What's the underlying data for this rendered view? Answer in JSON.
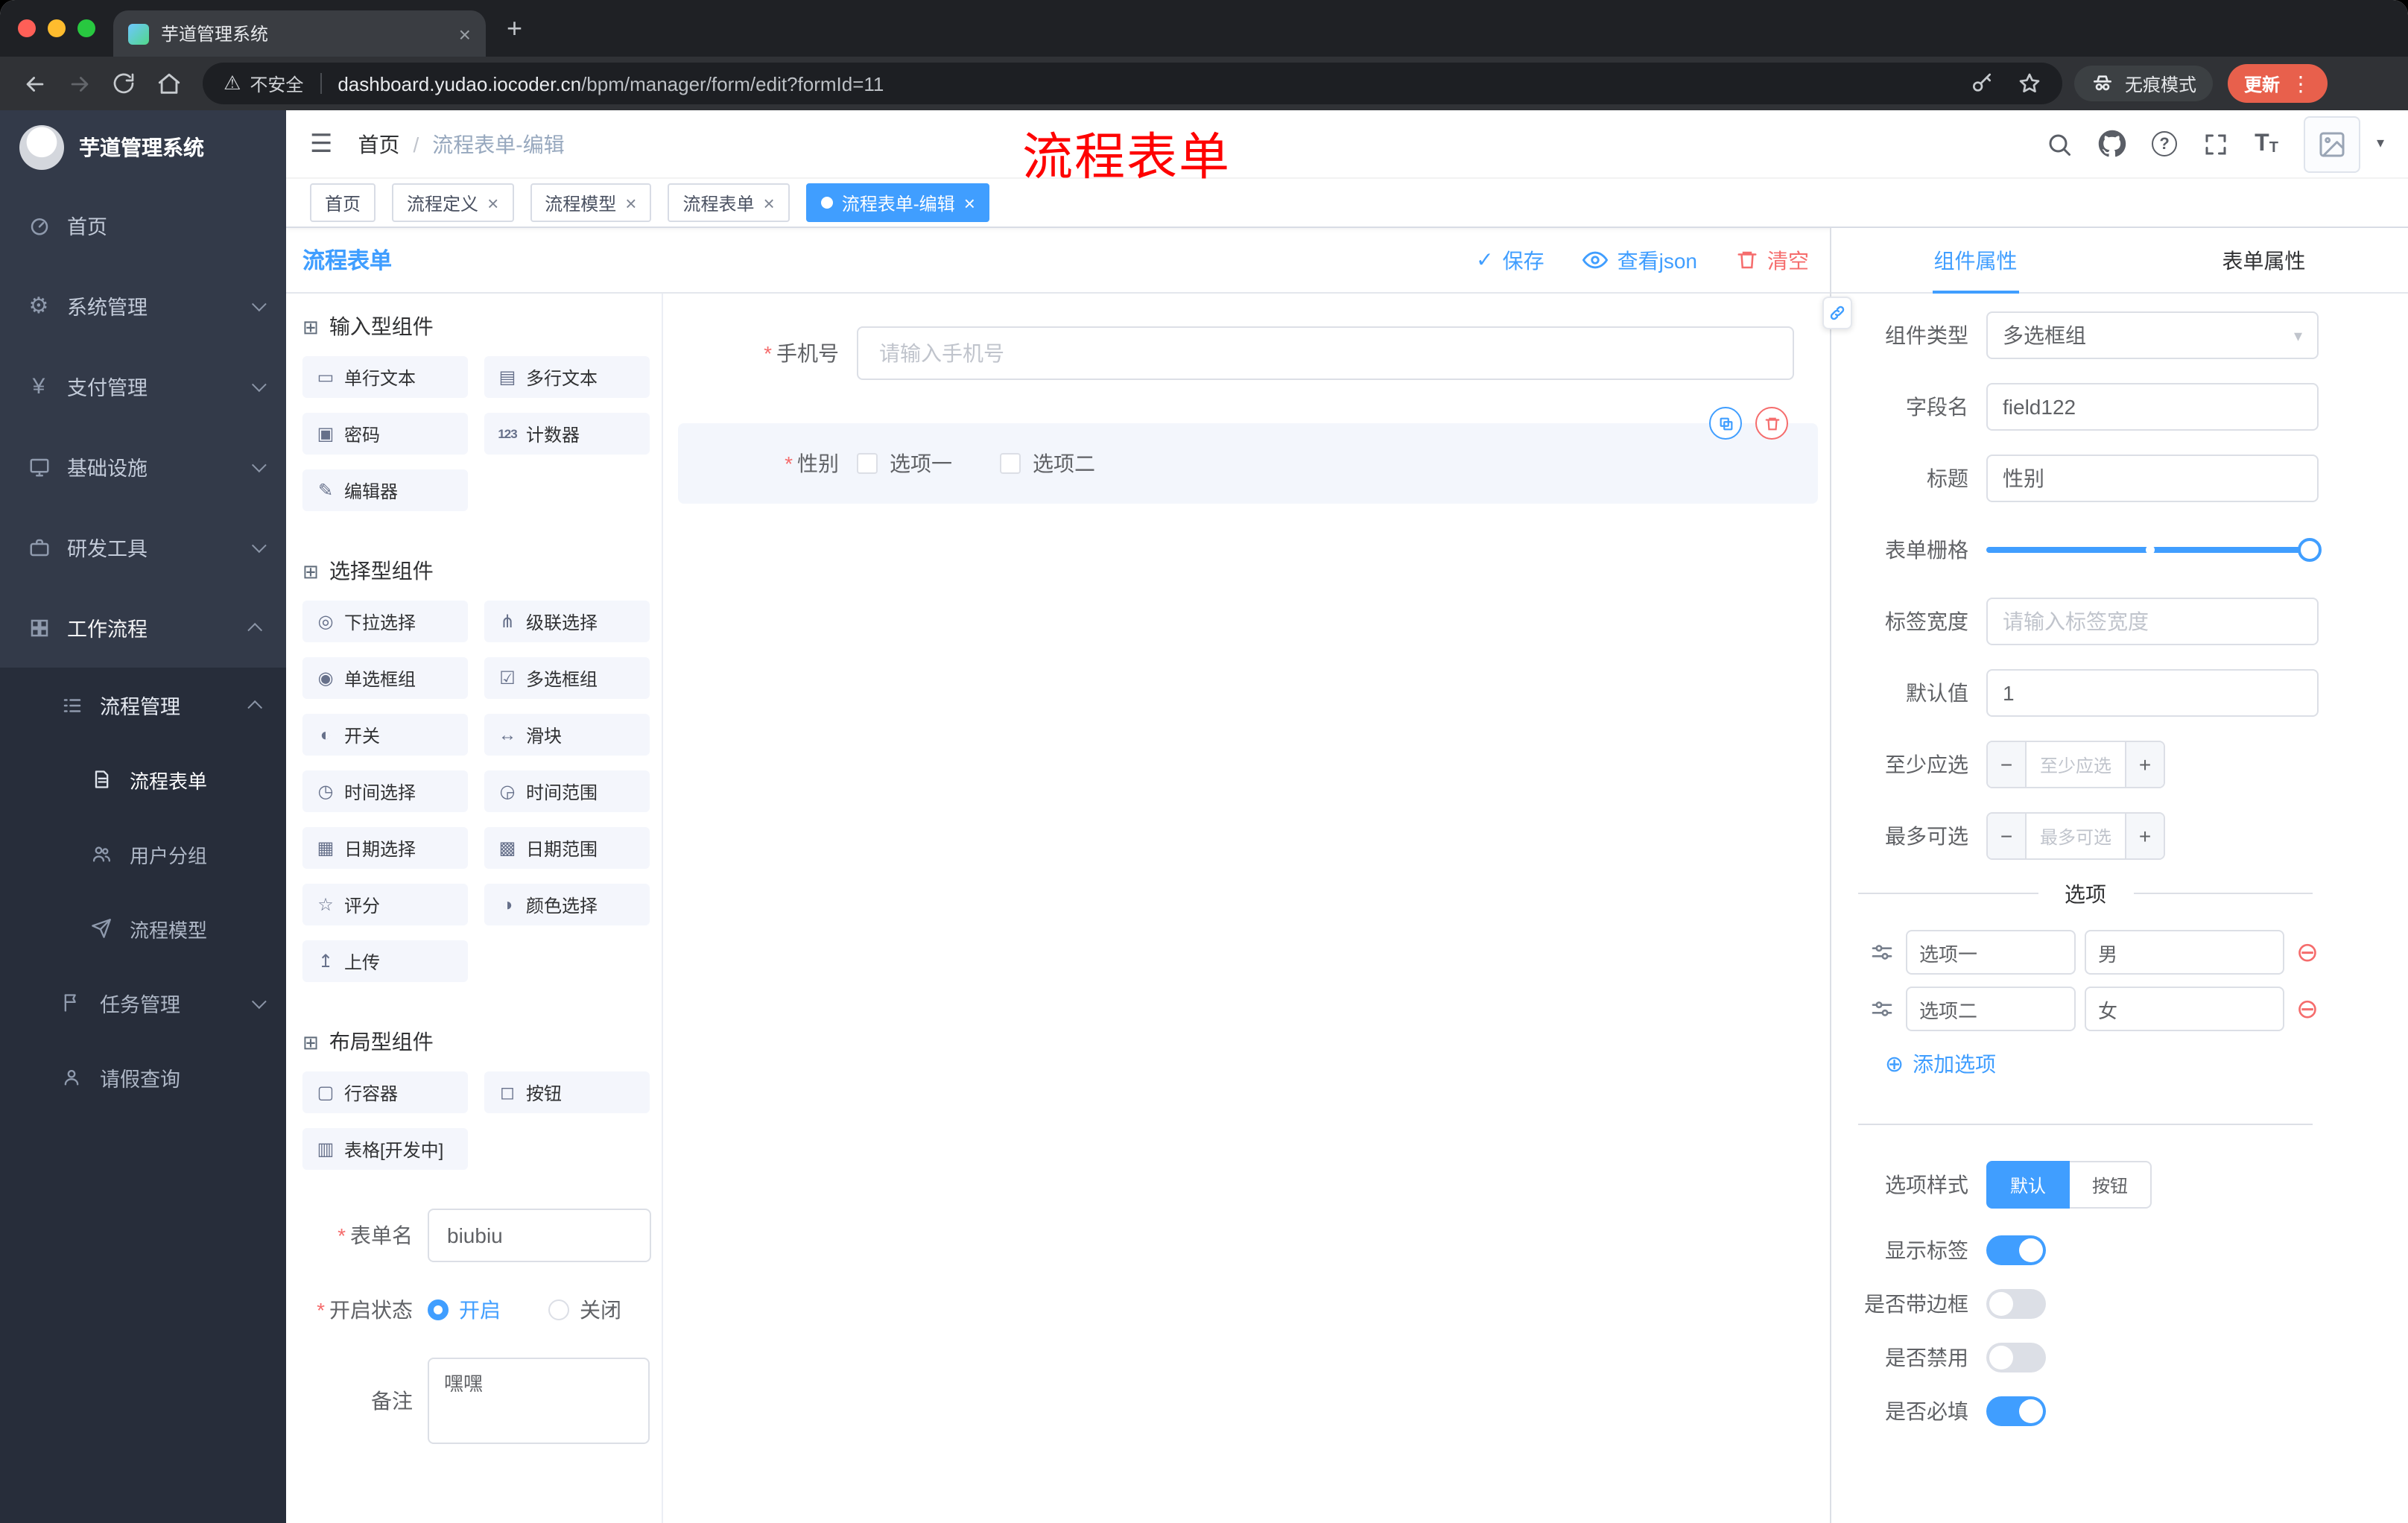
{
  "colors": {
    "accent": "#409eff",
    "danger": "#f56c6c",
    "sidebar_bg": "#333a49",
    "submenu_bg": "#272d3a",
    "annotation": "#fe0100",
    "update_pill": "#e8604c"
  },
  "glyphs": {
    "hamburger": "☰",
    "breadcrumb_sep": "/",
    "close": "×",
    "new_tab": "+",
    "kebab": "⋮",
    "caret_down": "▾",
    "warning": "⚠",
    "help": "?",
    "font_large": "T",
    "font_small": "T",
    "check": "✓",
    "add_circle": "⊕",
    "remove_circle": "⊖",
    "select_caret": "▾",
    "group_icon": "⊞",
    "required": "*",
    "gear": "⚙",
    "yen": "¥"
  },
  "browser": {
    "tab_title": "芋道管理系统",
    "security_label": "不安全",
    "url_host": "dashboard.yudao.iocoder.cn",
    "url_path": "/bpm/manager/form/edit?formId=11",
    "incognito_label": "无痕模式",
    "update_label": "更新"
  },
  "annotation": {
    "text": "流程表单"
  },
  "sidebar": {
    "logo_title": "芋道管理系统",
    "items": [
      {
        "label": "首页",
        "icon": "dashboard-icon"
      },
      {
        "label": "系统管理",
        "icon": "gear-icon"
      },
      {
        "label": "支付管理",
        "icon": "yen-icon"
      },
      {
        "label": "基础设施",
        "icon": "monitor-icon"
      },
      {
        "label": "研发工具",
        "icon": "briefcase-icon"
      },
      {
        "label": "工作流程",
        "icon": "grid-icon",
        "expanded": true
      }
    ],
    "submenu": [
      {
        "label": "流程管理",
        "icon": "list-icon",
        "expanded": true
      },
      {
        "label": "流程表单",
        "icon": "document-icon",
        "active": true
      },
      {
        "label": "用户分组",
        "icon": "users-icon"
      },
      {
        "label": "流程模型",
        "icon": "send-icon"
      },
      {
        "label": "任务管理",
        "icon": "flag-icon"
      },
      {
        "label": "请假查询",
        "icon": "user-icon"
      }
    ]
  },
  "header": {
    "breadcrumb_home": "首页",
    "breadcrumb_current": "流程表单-编辑"
  },
  "tags": [
    {
      "label": "首页"
    },
    {
      "label": "流程定义"
    },
    {
      "label": "流程模型"
    },
    {
      "label": "流程表单"
    },
    {
      "label": "流程表单-编辑",
      "active": true
    }
  ],
  "designer": {
    "title": "流程表单",
    "save": "保存",
    "view_json": "查看json",
    "clear": "清空",
    "groups": [
      {
        "title": "输入型组件",
        "items": [
          {
            "label": "单行文本",
            "glyph": "▭",
            "icon": "single-line-icon"
          },
          {
            "label": "多行文本",
            "glyph": "▤",
            "icon": "multi-line-icon"
          },
          {
            "label": "密码",
            "glyph": "▣",
            "icon": "lock-icon"
          },
          {
            "label": "计数器",
            "glyph": "123",
            "icon": "counter-icon"
          },
          {
            "label": "编辑器",
            "glyph": "✎",
            "icon": "editor-icon"
          }
        ]
      },
      {
        "title": "选择型组件",
        "items": [
          {
            "label": "下拉选择",
            "glyph": "◎",
            "icon": "select-icon"
          },
          {
            "label": "级联选择",
            "glyph": "⋔",
            "icon": "cascade-icon"
          },
          {
            "label": "单选框组",
            "glyph": "◉",
            "icon": "radio-icon"
          },
          {
            "label": "多选框组",
            "glyph": "☑",
            "icon": "checkbox-icon"
          },
          {
            "label": "开关",
            "glyph": "◐",
            "icon": "switch-icon"
          },
          {
            "label": "滑块",
            "glyph": "↔",
            "icon": "slider-icon"
          },
          {
            "label": "时间选择",
            "glyph": "◷",
            "icon": "time-icon"
          },
          {
            "label": "时间范围",
            "glyph": "◶",
            "icon": "time-range-icon"
          },
          {
            "label": "日期选择",
            "glyph": "▦",
            "icon": "date-icon"
          },
          {
            "label": "日期范围",
            "glyph": "▩",
            "icon": "date-range-icon"
          },
          {
            "label": "评分",
            "glyph": "☆",
            "icon": "rate-icon"
          },
          {
            "label": "颜色选择",
            "glyph": "◑",
            "icon": "color-icon"
          },
          {
            "label": "上传",
            "glyph": "↥",
            "icon": "upload-icon"
          }
        ]
      },
      {
        "title": "布局型组件",
        "items": [
          {
            "label": "行容器",
            "glyph": "▢",
            "icon": "row-icon"
          },
          {
            "label": "按钮",
            "glyph": "◻",
            "icon": "button-icon"
          },
          {
            "label": "表格[开发中]",
            "glyph": "▥",
            "icon": "table-icon"
          }
        ]
      }
    ],
    "meta": {
      "name_label": "表单名",
      "name_value": "biubiu",
      "status_label": "开启状态",
      "status_on": "开启",
      "status_off": "关闭",
      "remark_label": "备注",
      "remark_value": "嘿嘿"
    },
    "canvas": {
      "phone_label": "手机号",
      "phone_placeholder": "请输入手机号",
      "gender_label": "性别",
      "gender_option1": "选项一",
      "gender_option2": "选项二"
    }
  },
  "props": {
    "tab_component": "组件属性",
    "tab_form": "表单属性",
    "rows": {
      "type_label": "组件类型",
      "type_value": "多选框组",
      "field_label": "字段名",
      "field_value": "field122",
      "title_label": "标题",
      "title_value": "性别",
      "grid_label": "表单栅格",
      "width_label": "标签宽度",
      "width_placeholder": "请输入标签宽度",
      "default_label": "默认值",
      "default_value": "1",
      "min_label": "至少应选",
      "min_placeholder": "至少应选",
      "max_label": "最多可选",
      "max_placeholder": "最多可选"
    },
    "options_title": "选项",
    "options": [
      {
        "name": "选项一",
        "value": "男"
      },
      {
        "name": "选项二",
        "value": "女"
      }
    ],
    "add_option": "添加选项",
    "style_label": "选项样式",
    "style_default": "默认",
    "style_button": "按钮",
    "switches": [
      {
        "label": "显示标签",
        "on": true
      },
      {
        "label": "是否带边框",
        "on": false
      },
      {
        "label": "是否禁用",
        "on": false
      },
      {
        "label": "是否必填",
        "on": true
      }
    ]
  }
}
